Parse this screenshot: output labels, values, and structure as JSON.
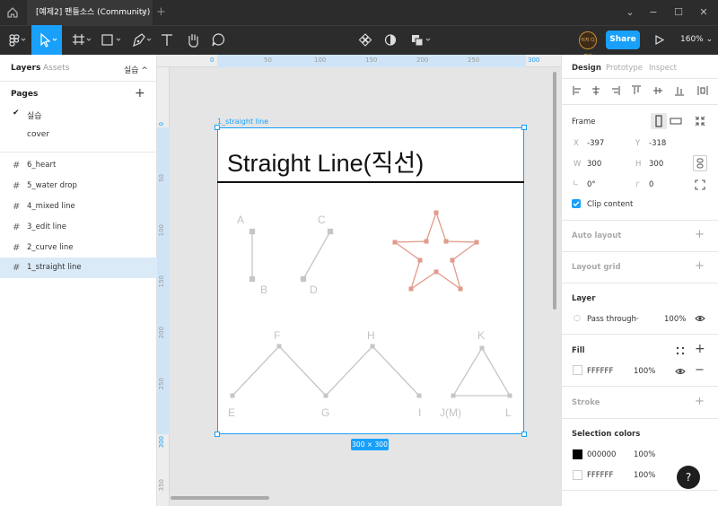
{
  "titlebar": {
    "tab_title": "[예제2] 팬들소스 (Community)",
    "tab_close": "×",
    "new_tab": "+",
    "minimize": "−",
    "maximize": "☐",
    "close": "✕",
    "chevron": "⌄"
  },
  "toolbar": {
    "share_label": "Share",
    "zoom_label": "160%",
    "avatar_text": "이지 디자인",
    "play_icon": "play-icon"
  },
  "left_panel": {
    "tabs": [
      "Layers",
      "Assets"
    ],
    "page_selector": "실습 ^",
    "pages_title": "Pages",
    "add_page": "+",
    "pages": [
      {
        "label": "실습",
        "checked": true
      },
      {
        "label": "cover",
        "checked": false
      }
    ],
    "layers": [
      {
        "label": "6_heart"
      },
      {
        "label": "5_water drop"
      },
      {
        "label": "4_mixed line"
      },
      {
        "label": "3_edit line"
      },
      {
        "label": "2_curve line"
      },
      {
        "label": "1_straight line",
        "selected": true
      }
    ]
  },
  "canvas": {
    "frame_name": "1_straight line",
    "frame_size_badge": "300 × 300",
    "heading": "Straight Line(직선)",
    "ruler_top": [
      "0",
      "50",
      "100",
      "150",
      "200",
      "250",
      "300"
    ],
    "ruler_left": [
      "0",
      "50",
      "100",
      "150",
      "200",
      "250",
      "300",
      "350"
    ],
    "points": {
      "A": "A",
      "B": "B",
      "C": "C",
      "D": "D",
      "E": "E",
      "F": "F",
      "G": "G",
      "H": "H",
      "I": "I",
      "K": "K",
      "J": "J(M)",
      "L": "L"
    },
    "colors": {
      "line_gray": "#c6c6c6",
      "star": "#e29a8a",
      "selection": "#18a0fb"
    }
  },
  "right_panel": {
    "tabs": [
      "Design",
      "Prototype",
      "Inspect"
    ],
    "frame_label": "Frame",
    "x_label": "X",
    "x_value": "-397",
    "y_label": "Y",
    "y_value": "-318",
    "w_label": "W",
    "w_value": "300",
    "h_label": "H",
    "h_value": "300",
    "rotation": "0°",
    "radius": "0",
    "clip_content": "Clip content",
    "auto_layout": "Auto layout",
    "layout_grid": "Layout grid",
    "layer_title": "Layer",
    "blend_mode": "Pass through",
    "layer_opacity": "100%",
    "fill_title": "Fill",
    "fill_hex": "FFFFFF",
    "fill_opacity": "100%",
    "stroke_title": "Stroke",
    "selection_colors_title": "Selection colors",
    "selection_colors": [
      {
        "hex": "000000",
        "opacity": "100%",
        "swatch": "#000000"
      },
      {
        "hex": "FFFFFF",
        "opacity": "100%",
        "swatch": "#FFFFFF"
      }
    ],
    "help": "?"
  }
}
